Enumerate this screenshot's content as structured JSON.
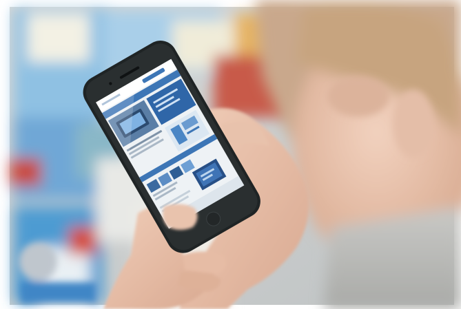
{
  "scene": {
    "icons": {
      "photo": "photo-scene",
      "phone": "smartphone-icon",
      "screen": "webpage-screenshot"
    },
    "colors": {
      "background": "#ffffff",
      "phone_body": "#2a2f30",
      "screen_bg": "#eef2f5",
      "web_accent": "#3d76b6",
      "skin": "#e9c6b1",
      "hair": "#c9a88c",
      "blur_blue": "#7fb4dd",
      "blur_red": "#c85a4a"
    }
  }
}
